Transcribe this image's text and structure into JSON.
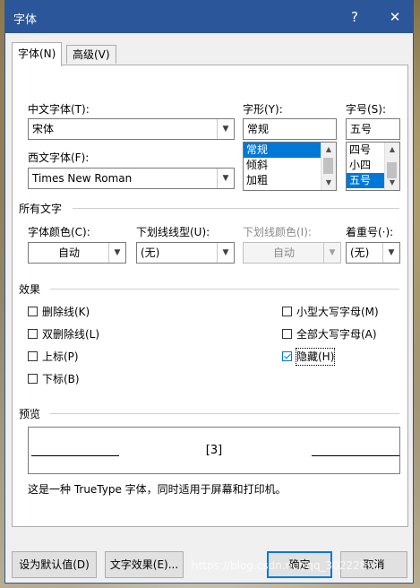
{
  "window": {
    "title": "字体",
    "help_label": "?",
    "close_label": "✕"
  },
  "tabs": [
    {
      "label": "字体(N)",
      "active": true
    },
    {
      "label": "高级(V)",
      "active": false
    }
  ],
  "font": {
    "chinese_label": "中文字体(T):",
    "chinese_value": "宋体",
    "western_label": "西文字体(F):",
    "western_value": "Times New Roman",
    "style_label": "字形(Y):",
    "style_value": "常规",
    "style_options": [
      "常规",
      "倾斜",
      "加粗"
    ],
    "size_label": "字号(S):",
    "size_value": "五号",
    "size_options": [
      "四号",
      "小四",
      "五号"
    ]
  },
  "all_text": {
    "section_title": "所有文字",
    "font_color_label": "字体颜色(C):",
    "font_color_value": "自动",
    "underline_style_label": "下划线线型(U):",
    "underline_style_value": "(无)",
    "underline_color_label": "下划线颜色(I):",
    "underline_color_value": "自动",
    "emphasis_label": "着重号(·):",
    "emphasis_value": "(无)"
  },
  "effects": {
    "section_title": "效果",
    "items": [
      {
        "label": "删除线(K)",
        "checked": false
      },
      {
        "label": "双删除线(L)",
        "checked": false
      },
      {
        "label": "上标(P)",
        "checked": false
      },
      {
        "label": "下标(B)",
        "checked": false
      },
      {
        "label": "小型大写字母(M)",
        "checked": false
      },
      {
        "label": "全部大写字母(A)",
        "checked": false
      },
      {
        "label": "隐藏(H)",
        "checked": true
      }
    ]
  },
  "preview": {
    "section_title": "预览",
    "sample_text": "[3]",
    "note": "这是一种 TrueType 字体，同时适用于屏幕和打印机。"
  },
  "buttons": {
    "set_default": "设为默认值(D)",
    "text_effects": "文字效果(E)...",
    "ok": "确定",
    "cancel": "取消"
  },
  "watermark": "https://blog.csdn.net/qq_30222891",
  "colors": {
    "titlebar": "#2b579a",
    "selection": "#0078d7"
  }
}
